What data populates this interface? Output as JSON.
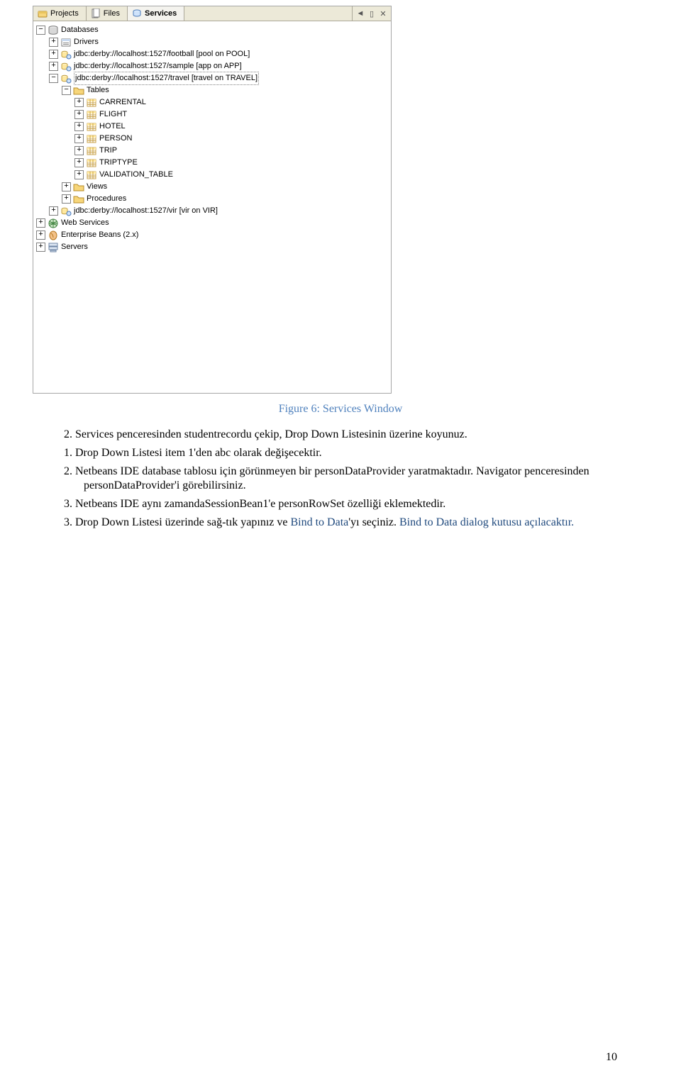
{
  "tabs": {
    "projects": "Projects",
    "files": "Files",
    "services": "Services"
  },
  "tree": {
    "databases": "Databases",
    "drivers": "Drivers",
    "conn_football": "jdbc:derby://localhost:1527/football [pool on POOL]",
    "conn_sample": "jdbc:derby://localhost:1527/sample [app on APP]",
    "conn_travel": "jdbc:derby://localhost:1527/travel [travel on TRAVEL]",
    "tables": "Tables",
    "t_carrental": "CARRENTAL",
    "t_flight": "FLIGHT",
    "t_hotel": "HOTEL",
    "t_person": "PERSON",
    "t_trip": "TRIP",
    "t_triptype": "TRIPTYPE",
    "t_validation": "VALIDATION_TABLE",
    "views": "Views",
    "procedures": "Procedures",
    "conn_vir": "jdbc:derby://localhost:1527/vir [vir on VIR]",
    "web_services": "Web Services",
    "enterprise_beans": "Enterprise Beans (2.x)",
    "servers": "Servers"
  },
  "twisty": {
    "plus": "+",
    "minus": "−"
  },
  "figure_caption": "Figure 6: Services Window",
  "text": {
    "p_2": "2.   Services penceresinden studentrecordu çekip, Drop Down Listesinin üzerine koyunuz.",
    "p_2_1": "1.   Drop Down Listesi item 1'den abc olarak değişecektir.",
    "p_2_2": "2.   Netbeans IDE database tablosu için görünmeyen bir personDataProvider yaratmaktadır. Navigator penceresinden personDataProvider'i görebilirsiniz.",
    "p_2_3": "3.    Netbeans IDE aynı zamandaSessionBean1'e personRowSet özelliği eklemektedir.",
    "p_3a": "3. Drop Down Listesi üzerinde sağ-tık yapınız ve ",
    "p_3b": "Bind to Data",
    "p_3c": "'yı seçiniz. ",
    "p_3d": "Bind to Data dialog kutusu açılacaktır."
  },
  "page_number": "10"
}
